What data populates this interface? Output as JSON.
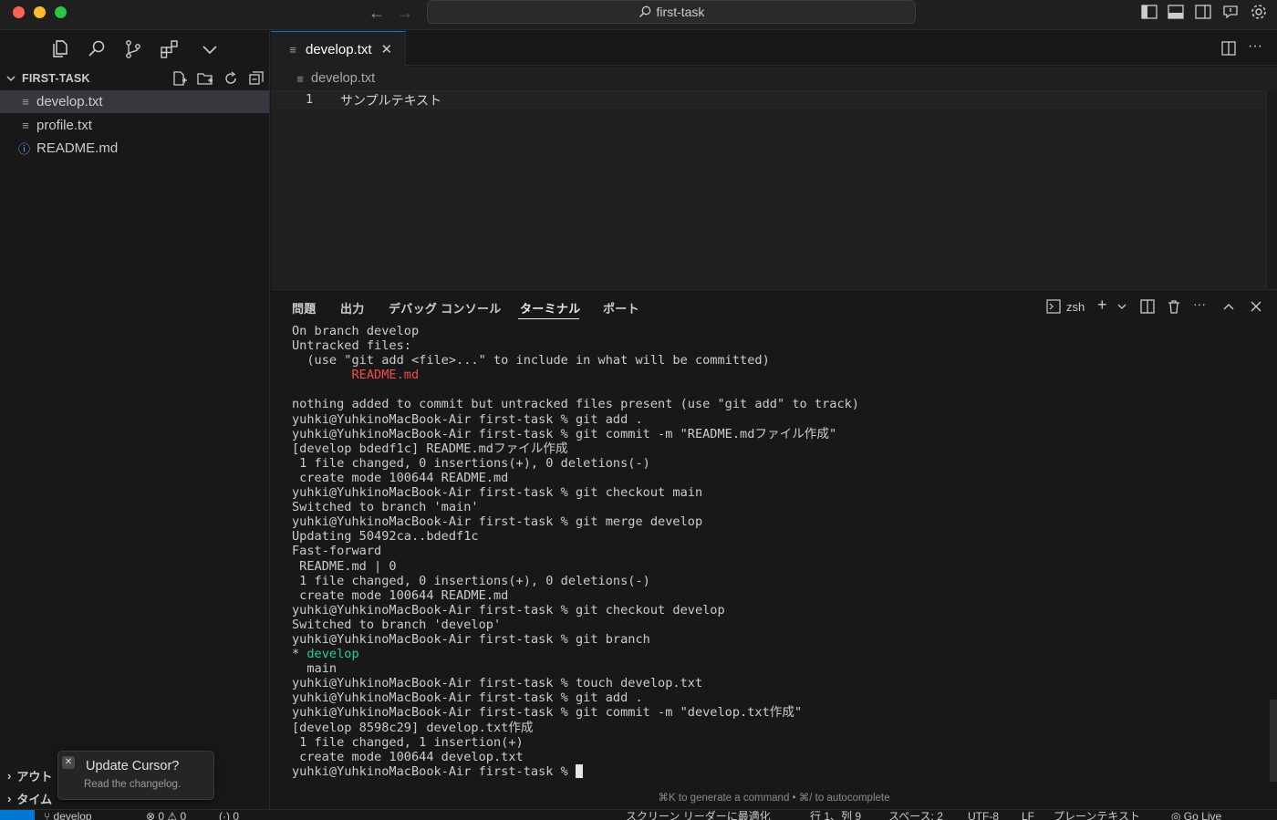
{
  "window": {
    "search_label": "first-task"
  },
  "sidebar": {
    "explorer_title": "FIRST-TASK",
    "files": [
      {
        "name": "develop.txt",
        "icon": "lines-icon",
        "active": true
      },
      {
        "name": "profile.txt",
        "icon": "lines-icon",
        "active": false
      },
      {
        "name": "README.md",
        "icon": "info-icon",
        "active": false
      }
    ],
    "sections": [
      {
        "label": "アウト"
      },
      {
        "label": "タイム"
      }
    ]
  },
  "editor": {
    "tab_label": "develop.txt",
    "breadcrumb": "develop.txt",
    "line_number": "1",
    "line_text": "サンプルテキスト"
  },
  "panel": {
    "tabs": [
      "問題",
      "出力",
      "デバッグ コンソール",
      "ターミナル",
      "ポート"
    ],
    "active_tab": "ターミナル",
    "shell": "zsh",
    "hint": "⌘K to generate a command • ⌘/ to autocomplete"
  },
  "terminal": {
    "lines": [
      "On branch develop",
      "Untracked files:",
      "  (use \"git add <file>...\" to include in what will be committed)",
      "        README.md",
      "",
      "nothing added to commit but untracked files present (use \"git add\" to track)",
      "yuhki@YuhkinoMacBook-Air first-task % git add .",
      "yuhki@YuhkinoMacBook-Air first-task % git commit -m \"README.mdファイル作成\"",
      "[develop bdedf1c] README.mdファイル作成",
      " 1 file changed, 0 insertions(+), 0 deletions(-)",
      " create mode 100644 README.md",
      "yuhki@YuhkinoMacBook-Air first-task % git checkout main",
      "Switched to branch 'main'",
      "yuhki@YuhkinoMacBook-Air first-task % git merge develop",
      "Updating 50492ca..bdedf1c",
      "Fast-forward",
      " README.md | 0",
      " 1 file changed, 0 insertions(+), 0 deletions(-)",
      " create mode 100644 README.md",
      "yuhki@YuhkinoMacBook-Air first-task % git checkout develop",
      "Switched to branch 'develop'",
      "yuhki@YuhkinoMacBook-Air first-task % git branch",
      "* develop",
      "  main",
      "yuhki@YuhkinoMacBook-Air first-task % touch develop.txt",
      "yuhki@YuhkinoMacBook-Air first-task % git add .",
      "yuhki@YuhkinoMacBook-Air first-task % git commit -m \"develop.txt作成\"",
      "[develop 8598c29] develop.txt作成",
      " 1 file changed, 1 insertion(+)",
      " create mode 100644 develop.txt",
      "yuhki@YuhkinoMacBook-Air first-task % "
    ]
  },
  "toast": {
    "title": "Update Cursor?",
    "subtitle": "Read the changelog."
  },
  "statusbar": {
    "branch": "develop",
    "problems": "⊗ 0 ⚠ 0",
    "ports": "(·) 0",
    "right_items": [
      "スクリーン リーダーに最適化",
      "行 1、列 9",
      "スペース: 2",
      "UTF-8",
      "LF",
      "プレーンテキスト",
      "◎ Go Live"
    ]
  },
  "colors": {
    "accent": "#0078d4",
    "terminal_red": "#f14c4c",
    "terminal_green": "#23d18b"
  }
}
